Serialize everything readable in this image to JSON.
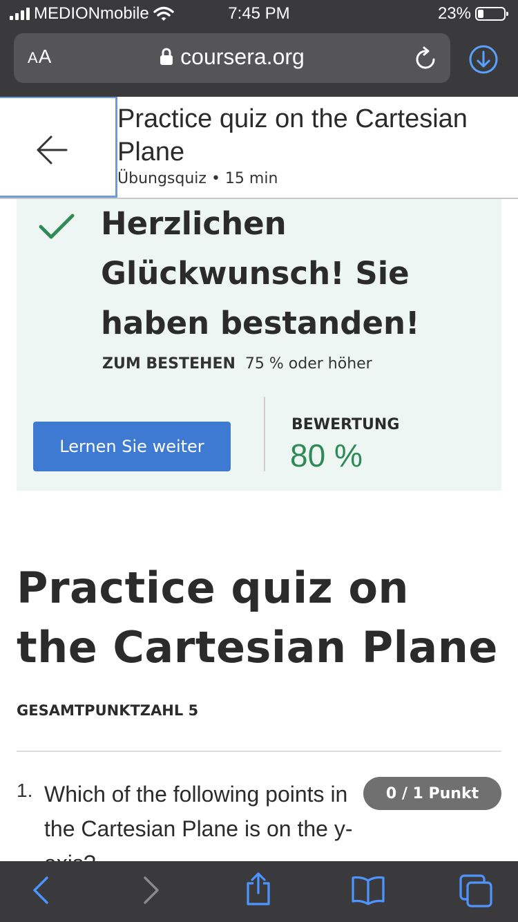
{
  "status_bar": {
    "carrier": "MEDIONmobile",
    "time": "7:45 PM",
    "battery": "23%"
  },
  "browser": {
    "text_size_label_small": "A",
    "text_size_label_large": "A",
    "url": "coursera.org",
    "icons": [
      "lock-icon",
      "reload-icon",
      "download-icon"
    ]
  },
  "header": {
    "title": "Practice quiz on the Cartesian Plane",
    "meta": "Übungsquiz • 15 min",
    "back_icon": "arrow-left-icon"
  },
  "result": {
    "message": "Herzlichen Glückwunsch! Sie haben bestanden!",
    "pass_label": "ZUM BESTEHEN",
    "pass_value": "75 % oder höher",
    "continue_label": "Lernen Sie weiter",
    "grade_label": "BEWERTUNG",
    "grade_value": "80 %",
    "colors": {
      "panel": "#eef6f3",
      "check": "#2e8b57",
      "button": "#3e7ad1",
      "grade": "#2e8b57"
    }
  },
  "quiz": {
    "title": "Practice quiz on the Cartesian Plane",
    "total_points": "GESAMTPUNKTZAHL 5",
    "question_number": "1.",
    "question_text": "Which of the following points in the Cartesian Plane is on the y-axis?",
    "points_badge": "0 / 1 Punkt"
  },
  "toolbar": {
    "icons": [
      "back-icon",
      "forward-icon",
      "share-icon",
      "bookmarks-icon",
      "tabs-icon"
    ]
  }
}
